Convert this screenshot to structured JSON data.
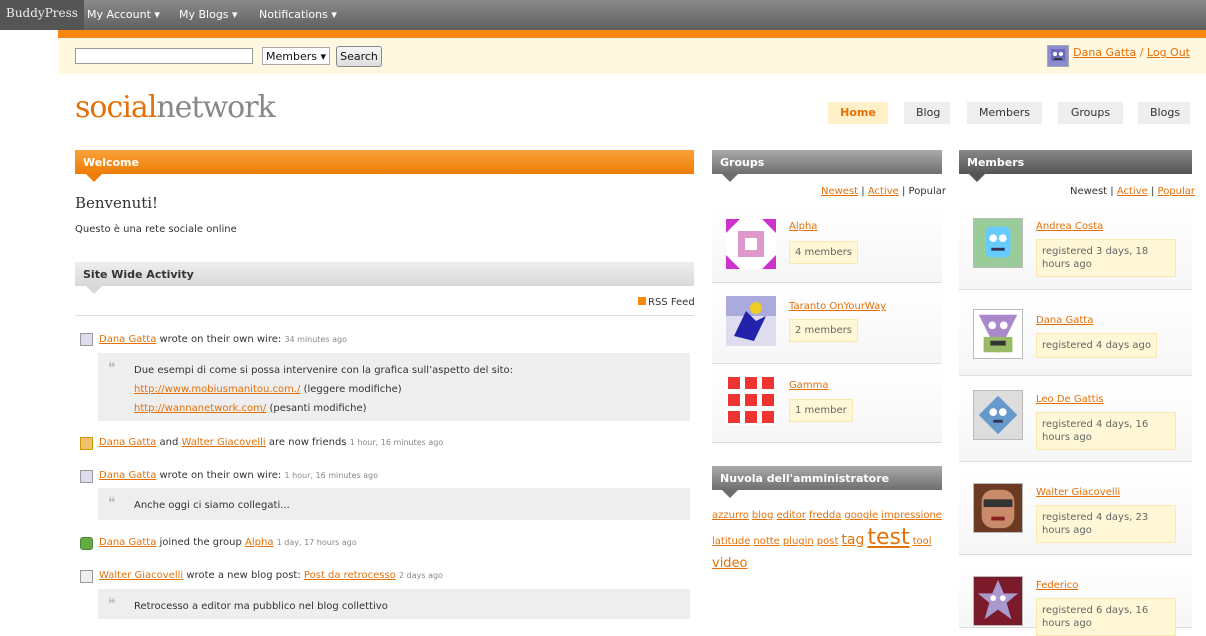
{
  "adminbar": {
    "logo": "BuddyPress",
    "menus": [
      "My Account ▾",
      "My Blogs ▾",
      "Notifications ▾"
    ]
  },
  "search": {
    "placeholder": "",
    "select": "Members ▾",
    "button": "Search"
  },
  "user": {
    "name": "Dana Gatta",
    "sep": " / ",
    "logout": "Log Out"
  },
  "site": {
    "title_a": "social",
    "title_b": "network"
  },
  "nav": [
    "Home",
    "Blog",
    "Members",
    "Groups",
    "Blogs"
  ],
  "welcome": {
    "header": "Welcome",
    "title": "Benvenuti!",
    "text": "Questo è una rete sociale online"
  },
  "activity": {
    "header": "Site Wide Activity",
    "rss": "RSS Feed",
    "items": [
      {
        "user": "Dana Gatta",
        "action": " wrote on their own wire: ",
        "time": "34 minutes ago"
      },
      {
        "user": "Dana Gatta",
        "mid": " and ",
        "user2": "Walter Giacovelli",
        "action": " are now friends ",
        "time": "1 hour, 16 minutes ago"
      },
      {
        "user": "Dana Gatta",
        "action": " wrote on their own wire: ",
        "time": "1 hour, 16 minutes ago"
      },
      {
        "user": "Dana Gatta",
        "action": " joined the group ",
        "link": "Alpha",
        "time": "1 day, 17 hours ago"
      },
      {
        "user": "Walter Giacovelli",
        "action": " wrote a new blog post: ",
        "link": "Post da retrocesso",
        "time": "2 days ago"
      }
    ],
    "quote1": {
      "line1": "Due esempi di come si possa intervenire con la grafica sull’aspetto del sito:",
      "link1": "http://www.mobiusmanitou.com./",
      "rest1": " (leggere modifiche)",
      "link2": "http://wannanetwork.com/",
      "rest2": " (pesanti modifiche)"
    },
    "quote2": "Anche oggi ci siamo collegati...",
    "quote3": "Retrocesso a editor ma pubblico nel blog collettivo"
  },
  "groups": {
    "header": "Groups",
    "filter": {
      "newest": "Newest",
      "sep": " | ",
      "active": "Active",
      "popular": "Popular"
    },
    "items": [
      {
        "name": "Alpha",
        "meta": "4 members"
      },
      {
        "name": "Taranto OnYourWay",
        "meta": "2 members"
      },
      {
        "name": "Gamma",
        "meta": "1 member"
      }
    ]
  },
  "tagcloud": {
    "header": "Nuvola dell'amministratore",
    "tags": [
      "azzurro",
      "blog",
      "editor",
      "fredda",
      "google",
      "impressione",
      "latitude",
      "notte",
      "plugin",
      "post",
      "tag",
      "test",
      "tool",
      "video"
    ]
  },
  "members": {
    "header": "Members",
    "filter": {
      "newest": "Newest",
      "sep": " | ",
      "active": "Active",
      "popular": "Popular"
    },
    "items": [
      {
        "name": "Andrea Costa",
        "meta": "registered 3 days, 18 hours ago"
      },
      {
        "name": "Dana Gatta",
        "meta": "registered 4 days ago"
      },
      {
        "name": "Leo De Gattis",
        "meta": "registered 4 days, 16 hours ago"
      },
      {
        "name": "Walter Giacovelli",
        "meta": "registered 4 days, 23 hours ago"
      },
      {
        "name": "Federico",
        "meta": "registered 6 days, 16 hours ago"
      }
    ]
  },
  "colors": {
    "accent": "#e37109",
    "bar_orange": "#f7870f",
    "admin_gray": "#6e6e6e"
  }
}
